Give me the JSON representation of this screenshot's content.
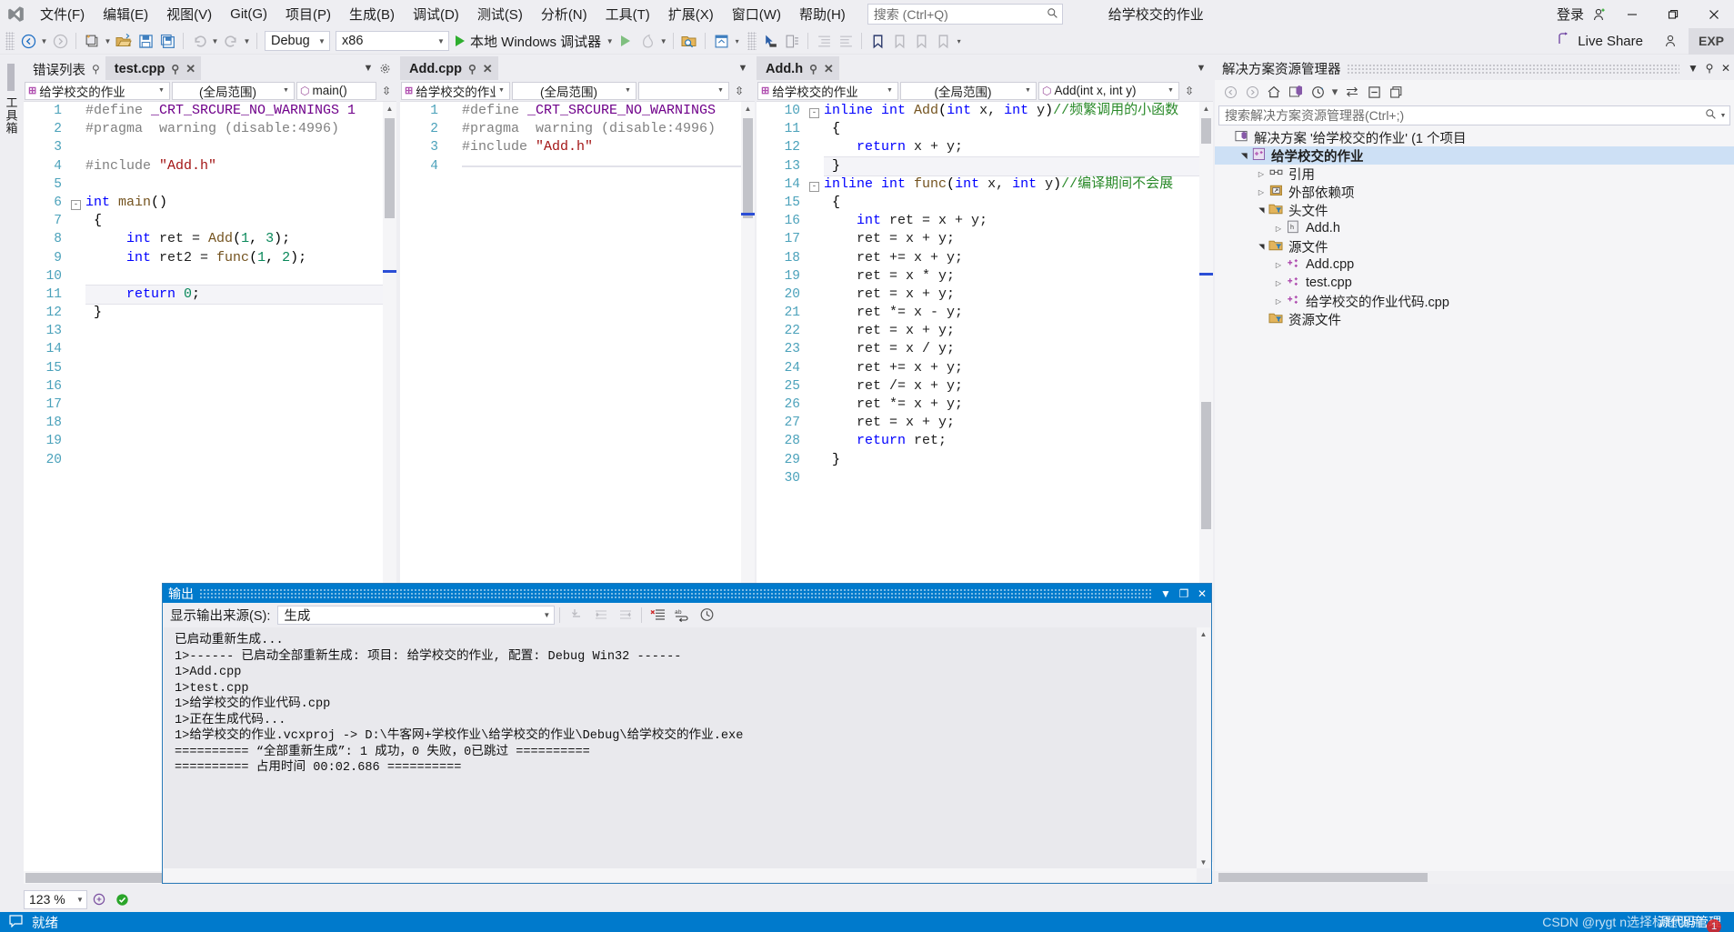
{
  "titlebar": {
    "logo_icon": "vs-logo-icon",
    "menus": [
      {
        "label": "文件(F)"
      },
      {
        "label": "编辑(E)"
      },
      {
        "label": "视图(V)"
      },
      {
        "label": "Git(G)"
      },
      {
        "label": "项目(P)"
      },
      {
        "label": "生成(B)"
      },
      {
        "label": "调试(D)"
      },
      {
        "label": "测试(S)"
      },
      {
        "label": "分析(N)"
      },
      {
        "label": "工具(T)"
      },
      {
        "label": "扩展(X)"
      },
      {
        "label": "窗口(W)"
      },
      {
        "label": "帮助(H)"
      }
    ],
    "search_placeholder": "搜索 (Ctrl+Q)",
    "search_icon": "search-icon",
    "caption": "给学校交的作业",
    "signin_label": "登录",
    "signin_icon": "account-icon",
    "minimize_icon": "minimize-icon",
    "restore_icon": "restore-icon",
    "close_icon": "close-icon"
  },
  "toolbar": {
    "nav_back_icon": "navigate-back-icon",
    "nav_forward_icon": "navigate-forward-icon",
    "new_project_icon": "new-project-icon",
    "open_icon": "open-file-icon",
    "save_icon": "save-icon",
    "save_all_icon": "save-all-icon",
    "undo_icon": "undo-icon",
    "redo_icon": "redo-icon",
    "configuration": "Debug",
    "platform": "x86",
    "run_label": "本地 Windows 调试器",
    "run_icon": "start-debug-icon",
    "attach_icon": "attach-process-icon",
    "hot_reload_icon": "hot-reload-icon",
    "find_in_files_icon": "find-in-files-icon",
    "solution_explorer_icon": "solution-explorer-icon",
    "pointer_icon": "pointer-select-icon",
    "comment_icon": "comment-icon",
    "indent_icon": "indent-icon",
    "outdent_icon": "outdent-icon",
    "bookmark_icon": "bookmark-icon",
    "bookmark_prev_icon": "bookmark-prev-icon",
    "bookmark_next_icon": "bookmark-next-icon",
    "bookmark_clear_icon": "bookmark-clear-icon",
    "live_share_label": "Live Share",
    "live_share_icon": "live-share-icon",
    "live_share_user_icon": "live-share-user-icon",
    "exp_label": "EXP"
  },
  "vertical_tab": {
    "label": "工具箱"
  },
  "editor_left": {
    "tabs": [
      {
        "label": "错误列表",
        "active": false,
        "pinned": true,
        "closable": false
      },
      {
        "label": "test.cpp",
        "active": true,
        "pinned": true,
        "closable": true
      }
    ],
    "nav_project": "给学校交的作业",
    "nav_scope": "(全局范围)",
    "nav_member": "main()",
    "tabstrip_dropdown_icon": "tab-list-dropdown-icon",
    "tabstrip_settings_icon": "settings-icon",
    "split_icon": "split-view-icon",
    "lines": [
      {
        "n": 1,
        "fold": "",
        "segs": [
          [
            "pre",
            "#define "
          ],
          [
            "macro",
            "_CRT_SRCURE_NO_WARNINGS 1"
          ]
        ]
      },
      {
        "n": 2,
        "fold": "",
        "segs": [
          [
            "pre",
            "#pragma  warning (disable:4996)"
          ]
        ]
      },
      {
        "n": 3,
        "fold": "",
        "segs": []
      },
      {
        "n": 4,
        "fold": "",
        "segs": [
          [
            "pre",
            "#include "
          ],
          [
            "str",
            "\"Add.h\""
          ]
        ]
      },
      {
        "n": 5,
        "fold": "",
        "segs": []
      },
      {
        "n": 6,
        "fold": "-",
        "segs": [
          [
            "kw",
            "int "
          ],
          [
            "fn",
            "main"
          ],
          [
            "op",
            "()"
          ]
        ]
      },
      {
        "n": 7,
        "fold": "",
        "segs": [
          [
            "op",
            " {"
          ]
        ]
      },
      {
        "n": 8,
        "fold": "",
        "segs": [
          [
            "op",
            "     "
          ],
          [
            "kw",
            "int "
          ],
          [
            "pln",
            "ret = "
          ],
          [
            "fn",
            "Add"
          ],
          [
            "op",
            "("
          ],
          [
            "num",
            "1"
          ],
          [
            "op",
            ", "
          ],
          [
            "num",
            "3"
          ],
          [
            "op",
            ");"
          ]
        ]
      },
      {
        "n": 9,
        "fold": "",
        "segs": [
          [
            "op",
            "     "
          ],
          [
            "kw",
            "int "
          ],
          [
            "pln",
            "ret2 = "
          ],
          [
            "fn",
            "func"
          ],
          [
            "op",
            "("
          ],
          [
            "num",
            "1"
          ],
          [
            "op",
            ", "
          ],
          [
            "num",
            "2"
          ],
          [
            "op",
            ");"
          ]
        ]
      },
      {
        "n": 10,
        "fold": "",
        "segs": []
      },
      {
        "n": 11,
        "fold": "",
        "segs": [
          [
            "op",
            "     "
          ],
          [
            "kw",
            "return "
          ],
          [
            "num",
            "0"
          ],
          [
            "op",
            ";"
          ]
        ],
        "highlight": true
      },
      {
        "n": 12,
        "fold": "",
        "segs": [
          [
            "op",
            " }"
          ]
        ]
      },
      {
        "n": 13,
        "fold": "",
        "segs": []
      },
      {
        "n": 14,
        "fold": "",
        "segs": []
      },
      {
        "n": 15,
        "fold": "",
        "segs": []
      },
      {
        "n": 16,
        "fold": "",
        "segs": []
      },
      {
        "n": 17,
        "fold": "",
        "segs": []
      },
      {
        "n": 18,
        "fold": "",
        "segs": []
      },
      {
        "n": 19,
        "fold": "",
        "segs": []
      },
      {
        "n": 20,
        "fold": "",
        "segs": []
      }
    ]
  },
  "editor_mid": {
    "tabs": [
      {
        "label": "Add.cpp",
        "active": true,
        "pinned": true,
        "closable": true
      }
    ],
    "nav_project": "给学校交的作业",
    "nav_scope": "(全局范围)",
    "nav_member": "",
    "lines": [
      {
        "n": 1,
        "fold": "",
        "segs": [
          [
            "pre",
            "#define "
          ],
          [
            "macro",
            "_CRT_SRCURE_NO_WARNINGS"
          ]
        ]
      },
      {
        "n": 2,
        "fold": "",
        "segs": [
          [
            "pre",
            "#pragma  warning (disable:4996)"
          ]
        ]
      },
      {
        "n": 3,
        "fold": "",
        "segs": [
          [
            "pre",
            "#include "
          ],
          [
            "str",
            "\"Add.h\""
          ]
        ]
      },
      {
        "n": 4,
        "fold": "",
        "segs": [],
        "highlight": true
      }
    ]
  },
  "editor_right": {
    "tabs": [
      {
        "label": "Add.h",
        "active": true,
        "pinned": true,
        "closable": true
      }
    ],
    "nav_project": "给学校交的作业",
    "nav_scope": "(全局范围)",
    "nav_member": "Add(int x, int y)",
    "lines": [
      {
        "n": 10,
        "fold": "-",
        "segs": [
          [
            "kw",
            "inline int "
          ],
          [
            "fn",
            "Add"
          ],
          [
            "op",
            "("
          ],
          [
            "kw",
            "int "
          ],
          [
            "pln",
            "x, "
          ],
          [
            "kw",
            "int "
          ],
          [
            "pln",
            "y"
          ],
          [
            "op",
            ")"
          ],
          [
            "cmt",
            "//频繁调用的小函数"
          ]
        ]
      },
      {
        "n": 11,
        "fold": "",
        "segs": [
          [
            "op",
            " {"
          ]
        ]
      },
      {
        "n": 12,
        "fold": "",
        "segs": [
          [
            "op",
            "    "
          ],
          [
            "kw",
            "return "
          ],
          [
            "pln",
            "x + y;"
          ]
        ]
      },
      {
        "n": 13,
        "fold": "",
        "segs": [
          [
            "op",
            " }"
          ]
        ],
        "highlight": true
      },
      {
        "n": 14,
        "fold": "-",
        "segs": [
          [
            "kw",
            "inline int "
          ],
          [
            "fn",
            "func"
          ],
          [
            "op",
            "("
          ],
          [
            "kw",
            "int "
          ],
          [
            "pln",
            "x, "
          ],
          [
            "kw",
            "int "
          ],
          [
            "pln",
            "y"
          ],
          [
            "op",
            ")"
          ],
          [
            "cmt",
            "//编译期间不会展"
          ]
        ]
      },
      {
        "n": 15,
        "fold": "",
        "segs": [
          [
            "op",
            " {"
          ]
        ]
      },
      {
        "n": 16,
        "fold": "",
        "segs": [
          [
            "op",
            "    "
          ],
          [
            "kw",
            "int "
          ],
          [
            "pln",
            "ret = x + y;"
          ]
        ]
      },
      {
        "n": 17,
        "fold": "",
        "segs": [
          [
            "op",
            "    "
          ],
          [
            "pln",
            "ret = x + y;"
          ]
        ]
      },
      {
        "n": 18,
        "fold": "",
        "segs": [
          [
            "op",
            "    "
          ],
          [
            "pln",
            "ret += x + y;"
          ]
        ]
      },
      {
        "n": 19,
        "fold": "",
        "segs": [
          [
            "op",
            "    "
          ],
          [
            "pln",
            "ret = x * y;"
          ]
        ]
      },
      {
        "n": 20,
        "fold": "",
        "segs": [
          [
            "op",
            "    "
          ],
          [
            "pln",
            "ret = x + y;"
          ]
        ]
      },
      {
        "n": 21,
        "fold": "",
        "segs": [
          [
            "op",
            "    "
          ],
          [
            "pln",
            "ret *= x - y;"
          ]
        ]
      },
      {
        "n": 22,
        "fold": "",
        "segs": [
          [
            "op",
            "    "
          ],
          [
            "pln",
            "ret = x + y;"
          ]
        ]
      },
      {
        "n": 23,
        "fold": "",
        "segs": [
          [
            "op",
            "    "
          ],
          [
            "pln",
            "ret = x / y;"
          ]
        ]
      },
      {
        "n": 24,
        "fold": "",
        "segs": [
          [
            "op",
            "    "
          ],
          [
            "pln",
            "ret += x + y;"
          ]
        ]
      },
      {
        "n": 25,
        "fold": "",
        "segs": [
          [
            "op",
            "    "
          ],
          [
            "pln",
            "ret /= x + y;"
          ]
        ]
      },
      {
        "n": 26,
        "fold": "",
        "segs": [
          [
            "op",
            "    "
          ],
          [
            "pln",
            "ret *= x + y;"
          ]
        ]
      },
      {
        "n": 27,
        "fold": "",
        "segs": [
          [
            "op",
            "    "
          ],
          [
            "pln",
            "ret = x + y;"
          ]
        ]
      },
      {
        "n": 28,
        "fold": "",
        "segs": [
          [
            "op",
            "    "
          ],
          [
            "kw",
            "return "
          ],
          [
            "pln",
            "ret;"
          ]
        ]
      },
      {
        "n": 29,
        "fold": "",
        "segs": [
          [
            "op",
            " }"
          ]
        ]
      },
      {
        "n": 30,
        "fold": "",
        "segs": []
      }
    ]
  },
  "solution_explorer": {
    "title": "解决方案资源管理器",
    "dropdown_icon": "chevron-down-icon",
    "pin_icon": "pin-icon",
    "close_icon": "close-icon",
    "tools": [
      {
        "icon": "back-icon",
        "name": "se-back"
      },
      {
        "icon": "forward-icon",
        "name": "se-forward"
      },
      {
        "icon": "home-icon",
        "name": "se-home"
      },
      {
        "icon": "solution-icon",
        "name": "se-solution"
      },
      {
        "icon": "pending-changes-icon",
        "name": "se-pending-changes"
      },
      {
        "icon": "sync-icon",
        "name": "se-sync"
      },
      {
        "icon": "collapse-all-icon",
        "name": "se-collapse-all"
      },
      {
        "icon": "properties-icon",
        "name": "se-properties"
      }
    ],
    "search_placeholder": "搜索解决方案资源管理器(Ctrl+;)",
    "search_icon": "search-icon",
    "tree": [
      {
        "label": "解决方案 '给学校交的作业' (1 个项目",
        "indent": 0,
        "twisty": "none",
        "icon": "solution-file-icon",
        "selected": false
      },
      {
        "label": "给学校交的作业",
        "indent": 1,
        "twisty": "down",
        "icon": "cpp-project-icon",
        "selected": true
      },
      {
        "label": "引用",
        "indent": 2,
        "twisty": "right",
        "icon": "references-icon",
        "selected": false
      },
      {
        "label": "外部依赖项",
        "indent": 2,
        "twisty": "right",
        "icon": "external-deps-icon",
        "selected": false
      },
      {
        "label": "头文件",
        "indent": 2,
        "twisty": "down",
        "icon": "filter-folder-icon",
        "selected": false
      },
      {
        "label": "Add.h",
        "indent": 3,
        "twisty": "right",
        "icon": "header-file-icon",
        "selected": false
      },
      {
        "label": "源文件",
        "indent": 2,
        "twisty": "down",
        "icon": "filter-folder-icon",
        "selected": false
      },
      {
        "label": "Add.cpp",
        "indent": 3,
        "twisty": "right",
        "icon": "cpp-file-icon",
        "selected": false
      },
      {
        "label": "test.cpp",
        "indent": 3,
        "twisty": "right",
        "icon": "cpp-file-icon",
        "selected": false
      },
      {
        "label": "给学校交的作业代码.cpp",
        "indent": 3,
        "twisty": "right",
        "icon": "cpp-file-icon",
        "selected": false
      },
      {
        "label": "资源文件",
        "indent": 2,
        "twisty": "none",
        "icon": "filter-folder-icon",
        "selected": false
      }
    ]
  },
  "output_window": {
    "title": "输出",
    "dropdown_icon": "chevron-down-icon",
    "maximize_icon": "maximize-icon",
    "close_icon": "close-icon",
    "source_label": "显示输出来源(S):",
    "source_value": "生成",
    "toolbar_icons": [
      {
        "name": "go-to-message-icon"
      },
      {
        "name": "previous-message-icon"
      },
      {
        "name": "next-message-icon"
      },
      {
        "name": "clear-all-icon"
      },
      {
        "name": "toggle-word-wrap-icon"
      },
      {
        "name": "toggle-timestamp-icon"
      }
    ],
    "lines": [
      "已启动重新生成...",
      "1>------ 已启动全部重新生成: 项目: 给学校交的作业, 配置: Debug Win32 ------",
      "1>Add.cpp",
      "1>test.cpp",
      "1>给学校交的作业代码.cpp",
      "1>正在生成代码...",
      "1>给学校交的作业.vcxproj -> D:\\牛客网+学校作业\\给学校交的作业\\Debug\\给学校交的作业.exe",
      "========== “全部重新生成”: 1 成功，0 失败，0已跳过 ==========",
      "========== 占用时间 00:02.686 =========="
    ]
  },
  "zoom_control": {
    "value": "123 %",
    "intellisense_icon": "intellisense-icon",
    "status_ok_icon": "status-ok-icon"
  },
  "statusbar": {
    "icon": "ready-balloon-icon",
    "text": "就绪",
    "source_control": "源代码管理",
    "watermark": "CSDN @rygt n选择标题明用",
    "watermark_badge": "1"
  },
  "colors": {
    "accent": "#007acc",
    "titlebar_bg": "#eeeef2",
    "editor_bg": "#ffffff",
    "keyword": "#0000ff",
    "preprocessor": "#808080",
    "macro": "#6f008a",
    "string": "#a31515",
    "number": "#09885a",
    "comment": "#2a8a2a",
    "function": "#74531f",
    "linenumber": "#2b91af",
    "selection": "#cde0f5"
  }
}
